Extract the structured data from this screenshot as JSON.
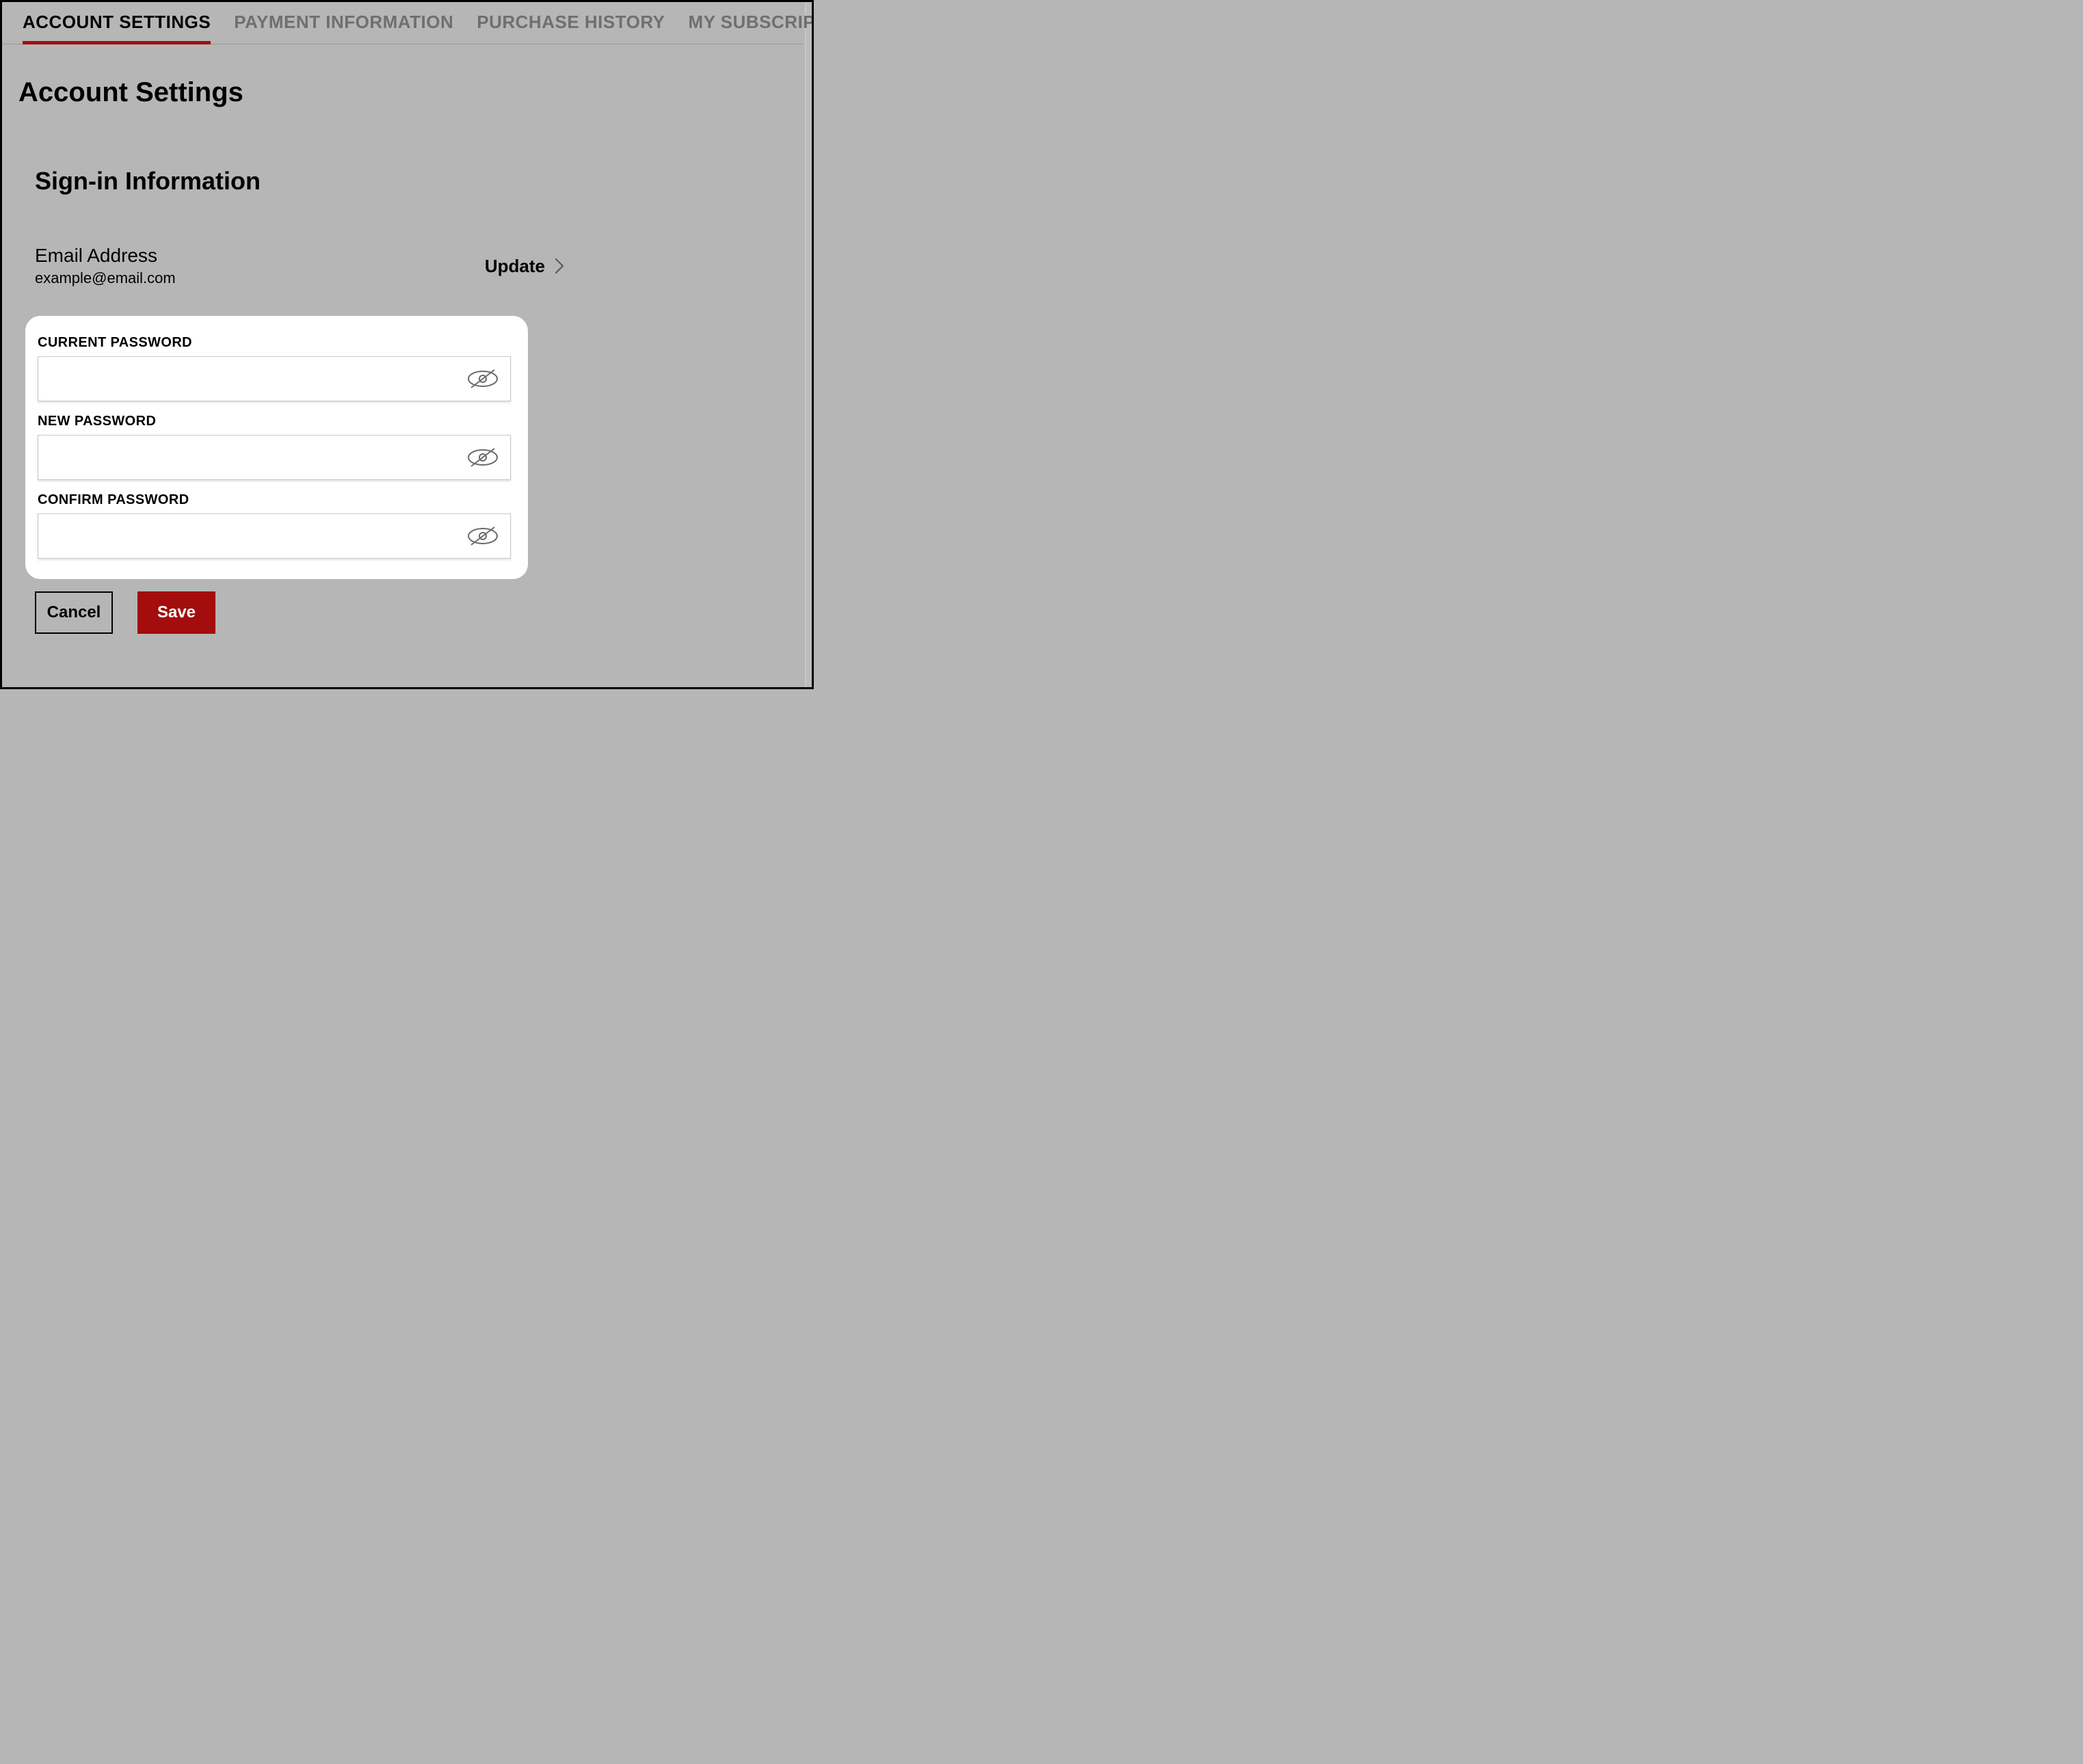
{
  "tabs": [
    {
      "label": "ACCOUNT SETTINGS",
      "active": true
    },
    {
      "label": "PAYMENT INFORMATION",
      "active": false
    },
    {
      "label": "PURCHASE HISTORY",
      "active": false
    },
    {
      "label": "MY SUBSCRIPTIONS",
      "active": false
    }
  ],
  "page_title": "Account Settings",
  "section_title": "Sign-in Information",
  "email": {
    "label": "Email Address",
    "value": "example@email.com",
    "update_label": "Update"
  },
  "password_card": {
    "fields": [
      {
        "label": "CURRENT PASSWORD",
        "value": ""
      },
      {
        "label": "NEW PASSWORD",
        "value": ""
      },
      {
        "label": "CONFIRM PASSWORD",
        "value": ""
      }
    ]
  },
  "buttons": {
    "cancel": "Cancel",
    "save": "Save"
  },
  "colors": {
    "accent": "#a30d0d",
    "background": "#b6b6b6"
  }
}
